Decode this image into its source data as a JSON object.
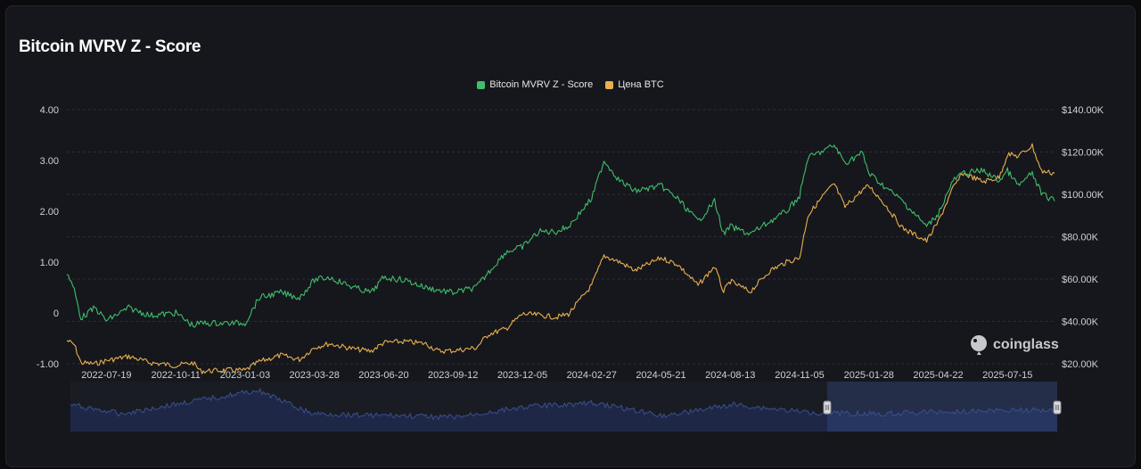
{
  "title": "Bitcoin MVRV Z - Score",
  "watermark": "coinglass",
  "colors": {
    "zscore": "#3fbd6b",
    "price": "#e8b04f",
    "navigator": "#3a4f8f",
    "grid": "#2c2e34"
  },
  "chart_data": {
    "type": "line",
    "title": "Bitcoin MVRV Z - Score",
    "legend_position": "top-center",
    "grid": true,
    "x_tick_labels": [
      "2022-07-19",
      "2022-10-11",
      "2023-01-03",
      "2023-03-28",
      "2023-06-20",
      "2023-09-12",
      "2023-12-05",
      "2024-02-27",
      "2024-05-21",
      "2024-08-13",
      "2024-11-05",
      "2025-01-28",
      "2025-04-22",
      "2025-07-15"
    ],
    "xlim": [
      "2022-06-01",
      "2025-09-10"
    ],
    "y_left": {
      "ticks": [
        "4.00",
        "3.00",
        "2.00",
        "1.00",
        "0",
        "-1.00"
      ],
      "ylim": [
        -1,
        4
      ]
    },
    "y_right": {
      "ticks": [
        "$140.00K",
        "$120.00K",
        "$100.00K",
        "$80.00K",
        "$60.00K",
        "$40.00K",
        "$20.00K"
      ],
      "ylim": [
        20000,
        140000
      ]
    },
    "series": [
      {
        "name": "Bitcoin MVRV Z - Score",
        "axis": "left",
        "x": [
          "2022-06-01",
          "2022-06-10",
          "2022-06-18",
          "2022-07-05",
          "2022-07-19",
          "2022-08-15",
          "2022-09-10",
          "2022-10-11",
          "2022-11-01",
          "2022-11-10",
          "2022-12-15",
          "2023-01-03",
          "2023-01-20",
          "2023-02-15",
          "2023-03-10",
          "2023-03-28",
          "2023-04-15",
          "2023-05-15",
          "2023-06-05",
          "2023-06-20",
          "2023-07-15",
          "2023-08-10",
          "2023-08-25",
          "2023-09-12",
          "2023-10-10",
          "2023-10-25",
          "2023-11-15",
          "2023-12-05",
          "2023-12-25",
          "2024-01-15",
          "2024-01-30",
          "2024-02-27",
          "2024-03-13",
          "2024-04-01",
          "2024-04-20",
          "2024-05-21",
          "2024-06-10",
          "2024-07-05",
          "2024-07-25",
          "2024-08-05",
          "2024-08-13",
          "2024-09-06",
          "2024-09-30",
          "2024-10-20",
          "2024-11-05",
          "2024-11-15",
          "2024-12-05",
          "2024-12-17",
          "2024-12-30",
          "2025-01-20",
          "2025-01-28",
          "2025-02-15",
          "2025-03-10",
          "2025-04-08",
          "2025-04-22",
          "2025-05-10",
          "2025-05-22",
          "2025-06-15",
          "2025-07-05",
          "2025-07-15",
          "2025-07-28",
          "2025-08-14",
          "2025-08-25",
          "2025-09-10"
        ],
        "y": [
          0.8,
          0.45,
          -0.1,
          0.1,
          -0.15,
          0.1,
          -0.05,
          0.0,
          -0.25,
          -0.2,
          -0.2,
          -0.2,
          0.3,
          0.4,
          0.3,
          0.65,
          0.7,
          0.5,
          0.4,
          0.7,
          0.65,
          0.5,
          0.45,
          0.4,
          0.5,
          0.8,
          1.2,
          1.3,
          1.6,
          1.6,
          1.7,
          2.25,
          3.0,
          2.6,
          2.4,
          2.5,
          2.25,
          1.8,
          2.2,
          1.55,
          1.7,
          1.55,
          1.8,
          2.0,
          2.3,
          3.05,
          3.2,
          3.3,
          2.95,
          3.15,
          2.75,
          2.5,
          2.2,
          1.7,
          1.95,
          2.6,
          2.75,
          2.8,
          2.6,
          2.8,
          2.5,
          2.75,
          2.35,
          2.2
        ]
      },
      {
        "name": "Цена BTC",
        "axis": "right",
        "x": [
          "2022-06-01",
          "2022-06-10",
          "2022-06-18",
          "2022-07-05",
          "2022-07-19",
          "2022-08-15",
          "2022-09-10",
          "2022-10-11",
          "2022-11-01",
          "2022-11-10",
          "2022-12-15",
          "2023-01-03",
          "2023-01-20",
          "2023-02-15",
          "2023-03-10",
          "2023-03-28",
          "2023-04-15",
          "2023-05-15",
          "2023-06-05",
          "2023-06-20",
          "2023-07-15",
          "2023-08-10",
          "2023-08-25",
          "2023-09-12",
          "2023-10-10",
          "2023-10-25",
          "2023-11-15",
          "2023-12-05",
          "2023-12-25",
          "2024-01-15",
          "2024-01-30",
          "2024-02-27",
          "2024-03-13",
          "2024-04-01",
          "2024-04-20",
          "2024-05-21",
          "2024-06-10",
          "2024-07-05",
          "2024-07-25",
          "2024-08-05",
          "2024-08-13",
          "2024-09-06",
          "2024-09-30",
          "2024-10-20",
          "2024-11-05",
          "2024-11-15",
          "2024-12-05",
          "2024-12-17",
          "2024-12-30",
          "2025-01-20",
          "2025-01-28",
          "2025-02-15",
          "2025-03-10",
          "2025-04-08",
          "2025-04-22",
          "2025-05-10",
          "2025-05-22",
          "2025-06-15",
          "2025-07-05",
          "2025-07-15",
          "2025-07-28",
          "2025-08-14",
          "2025-08-25",
          "2025-09-10"
        ],
        "y": [
          31000,
          29000,
          20500,
          20000,
          21500,
          23500,
          20500,
          19200,
          20500,
          16500,
          17000,
          16800,
          21000,
          24000,
          22000,
          27800,
          29500,
          27000,
          26000,
          30000,
          30500,
          29500,
          26000,
          26200,
          27500,
          34000,
          36500,
          43500,
          43000,
          42000,
          43500,
          57000,
          71000,
          68000,
          64000,
          70000,
          67000,
          57000,
          66000,
          54000,
          59000,
          54000,
          64000,
          68000,
          70000,
          90000,
          100000,
          105000,
          94000,
          102000,
          104000,
          96000,
          84000,
          78000,
          87000,
          103000,
          110000,
          106000,
          108000,
          119000,
          118000,
          123000,
          111000,
          110000
        ]
      }
    ],
    "navigator": {
      "type": "area",
      "x": [
        "2022-06-01",
        "2022-08-01",
        "2022-11-10",
        "2023-01-15",
        "2023-03-20",
        "2023-06-20",
        "2023-09-12",
        "2023-12-05",
        "2024-02-27",
        "2024-05-21",
        "2024-08-13",
        "2024-11-05",
        "2025-01-28",
        "2025-04-22",
        "2025-07-15",
        "2025-09-10"
      ],
      "y": [
        0.55,
        0.3,
        0.7,
        0.95,
        0.3,
        0.25,
        0.2,
        0.5,
        0.6,
        0.25,
        0.55,
        0.35,
        0.3,
        0.35,
        0.4,
        0.4
      ],
      "selection": [
        "2024-12-05",
        "2025-09-10"
      ]
    }
  }
}
